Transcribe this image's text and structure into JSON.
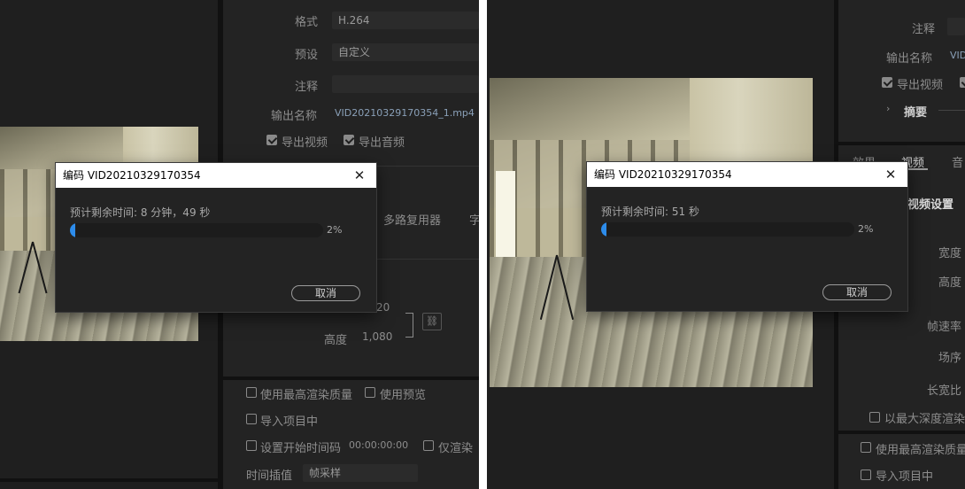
{
  "left_screen": {
    "format_label": "格式",
    "format_value": "H.264",
    "preset_label": "预设",
    "preset_value": "自定义",
    "comment_label": "注释",
    "comment_value": "",
    "output_name_label": "输出名称",
    "output_name_value": "VID20210329170354_1.mp4",
    "export_video": "导出视频",
    "export_audio": "导出音频",
    "tab_multiplexer": "多路复用器",
    "tab_partial": "字",
    "width_value_partial": "20",
    "height_label": "高度",
    "height_value": "1,080",
    "use_max_render_quality": "使用最高渲染质量",
    "use_preview": "使用预览",
    "import_into_project": "导入项目中",
    "set_start_timecode": "设置开始时间码",
    "start_timecode": "00:00:00:00",
    "render_only": "仅渲染",
    "time_interpolation_label": "时间插值",
    "time_interpolation_value": "帧采样",
    "dialog": {
      "title": "编码 VID20210329170354",
      "close": "✕",
      "remaining": "预计剩余时间: 8 分钟，49 秒",
      "progress": 0.02,
      "progress_text": "2%",
      "cancel": "取消"
    }
  },
  "right_screen": {
    "comment_label": "注释",
    "output_name_label": "输出名称",
    "output_name_value": "VID",
    "export_video": "导出视频",
    "summary": "摘要",
    "tab_effects": "效果",
    "tab_video": "视频",
    "tab_audio": "音",
    "video_settings": "视频设置",
    "width_label": "宽度",
    "height_label": "高度",
    "frame_rate_label": "帧速率",
    "field_order_label": "场序",
    "aspect_label": "长宽比",
    "max_depth": "以最大深度渲染",
    "use_max_render_quality": "使用最高渲染质量",
    "import_into_project": "导入项目中",
    "dialog": {
      "title": "编码 VID20210329170354",
      "close": "✕",
      "remaining": "预计剩余时间: 51 秒",
      "progress": 0.02,
      "progress_text": "2%",
      "cancel": "取消"
    }
  },
  "colors": {
    "accent": "#2d8ceb",
    "panel_bg": "#232323",
    "app_bg": "#1e1e1e"
  }
}
